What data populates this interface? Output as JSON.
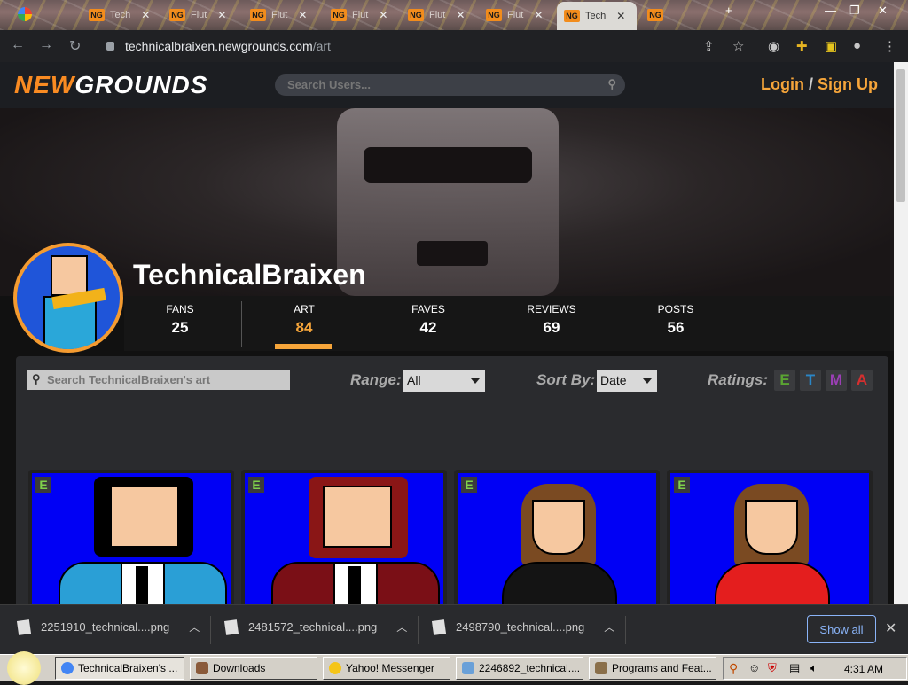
{
  "browser": {
    "tabs": [
      {
        "label": "Tech",
        "active": false
      },
      {
        "label": "Flut",
        "active": false
      },
      {
        "label": "Flut",
        "active": false
      },
      {
        "label": "Flut",
        "active": false
      },
      {
        "label": "Flut",
        "active": false
      },
      {
        "label": "Flut",
        "active": false
      },
      {
        "label": "Tech",
        "active": true
      },
      {
        "label": "",
        "active": false
      }
    ],
    "url_host": "technicalbraixen.newgrounds.com",
    "url_path": "/art"
  },
  "site": {
    "logo_new": "NEW",
    "logo_grounds": "GROUNDS",
    "search_placeholder": "Search Users...",
    "login": "Login",
    "slash": "/",
    "signup": "Sign Up"
  },
  "profile": {
    "username": "TechnicalBraixen",
    "stats": [
      {
        "label": "FANS",
        "value": "25"
      },
      {
        "label": "ART",
        "value": "84"
      },
      {
        "label": "FAVES",
        "value": "42"
      },
      {
        "label": "REVIEWS",
        "value": "69"
      },
      {
        "label": "POSTS",
        "value": "56"
      }
    ]
  },
  "gallery": {
    "search_placeholder": "Search TechnicalBraixen's art",
    "range_label": "Range:",
    "range_value": "All",
    "sort_label": "Sort By:",
    "sort_value": "Date",
    "ratings_label": "Ratings:",
    "ratings": [
      {
        "letter": "E",
        "color": "#5aa332"
      },
      {
        "letter": "T",
        "color": "#2a86c7"
      },
      {
        "letter": "M",
        "color": "#9b3fb5"
      },
      {
        "letter": "A",
        "color": "#d62f2f"
      }
    ],
    "cards": [
      {
        "badge": "E"
      },
      {
        "badge": "E"
      },
      {
        "badge": "E"
      },
      {
        "badge": "E"
      }
    ]
  },
  "downloads": {
    "items": [
      "2251910_technical....png",
      "2481572_technical....png",
      "2498790_technical....png"
    ],
    "show_all": "Show all"
  },
  "taskbar": {
    "items": [
      "TechnicalBraixen's ...",
      "Downloads",
      "Yahoo! Messenger",
      "2246892_technical....",
      "Programs and Feat..."
    ],
    "clock": "4:31 AM"
  },
  "colors": {
    "accent": "#f6a53a",
    "ng_orange": "#f98b22",
    "art_blue": "#0000f5"
  }
}
